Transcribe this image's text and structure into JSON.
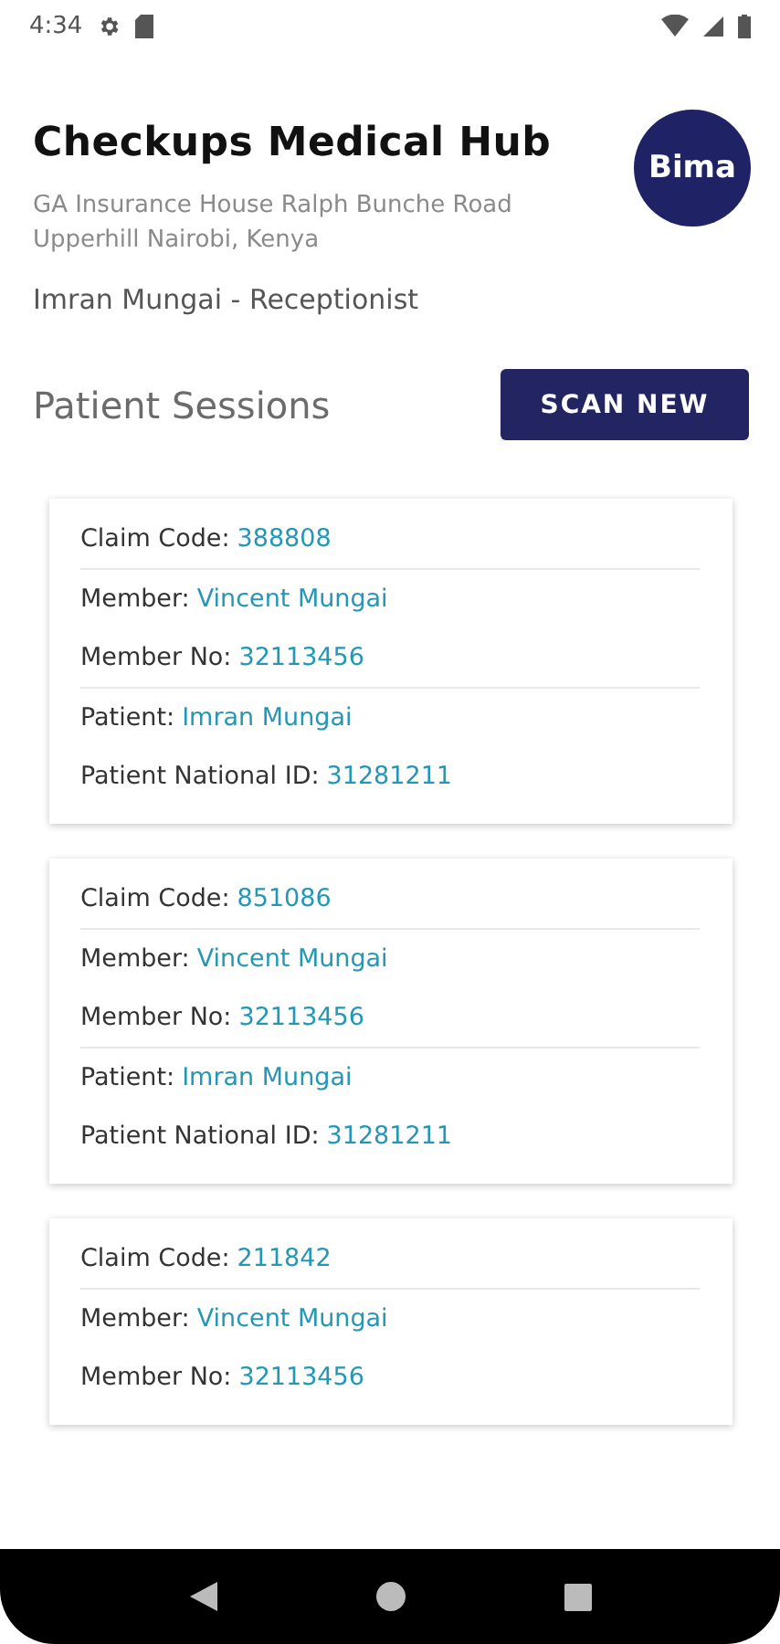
{
  "status_bar": {
    "time": "4:34"
  },
  "header": {
    "title": "Checkups Medical Hub",
    "address_lines": [
      "GA Insurance House Ralph Bunche Road",
      "Upperhill  Nairobi, Kenya"
    ],
    "user": "Imran Mungai - Receptionist",
    "logo_text": "Bima"
  },
  "sessions_heading": "Patient Sessions",
  "scan_button": "SCAN NEW",
  "sessions": [
    {
      "groups": [
        [
          {
            "label": "Claim Code:",
            "value": "388808"
          }
        ],
        [
          {
            "label": "Member:",
            "value": "Vincent Mungai"
          },
          {
            "label": "Member No:",
            "value": "32113456"
          }
        ],
        [
          {
            "label": "Patient:",
            "value": "Imran Mungai"
          },
          {
            "label": "Patient National ID:",
            "value": "31281211"
          }
        ]
      ]
    },
    {
      "groups": [
        [
          {
            "label": "Claim Code:",
            "value": "851086"
          }
        ],
        [
          {
            "label": "Member:",
            "value": "Vincent Mungai"
          },
          {
            "label": "Member No:",
            "value": "32113456"
          }
        ],
        [
          {
            "label": "Patient:",
            "value": "Imran Mungai"
          },
          {
            "label": "Patient National ID:",
            "value": "31281211"
          }
        ]
      ]
    },
    {
      "groups": [
        [
          {
            "label": "Claim Code:",
            "value": "211842"
          }
        ],
        [
          {
            "label": "Member:",
            "value": "Vincent Mungai"
          },
          {
            "label": "Member No:",
            "value": "32113456"
          }
        ]
      ]
    }
  ]
}
